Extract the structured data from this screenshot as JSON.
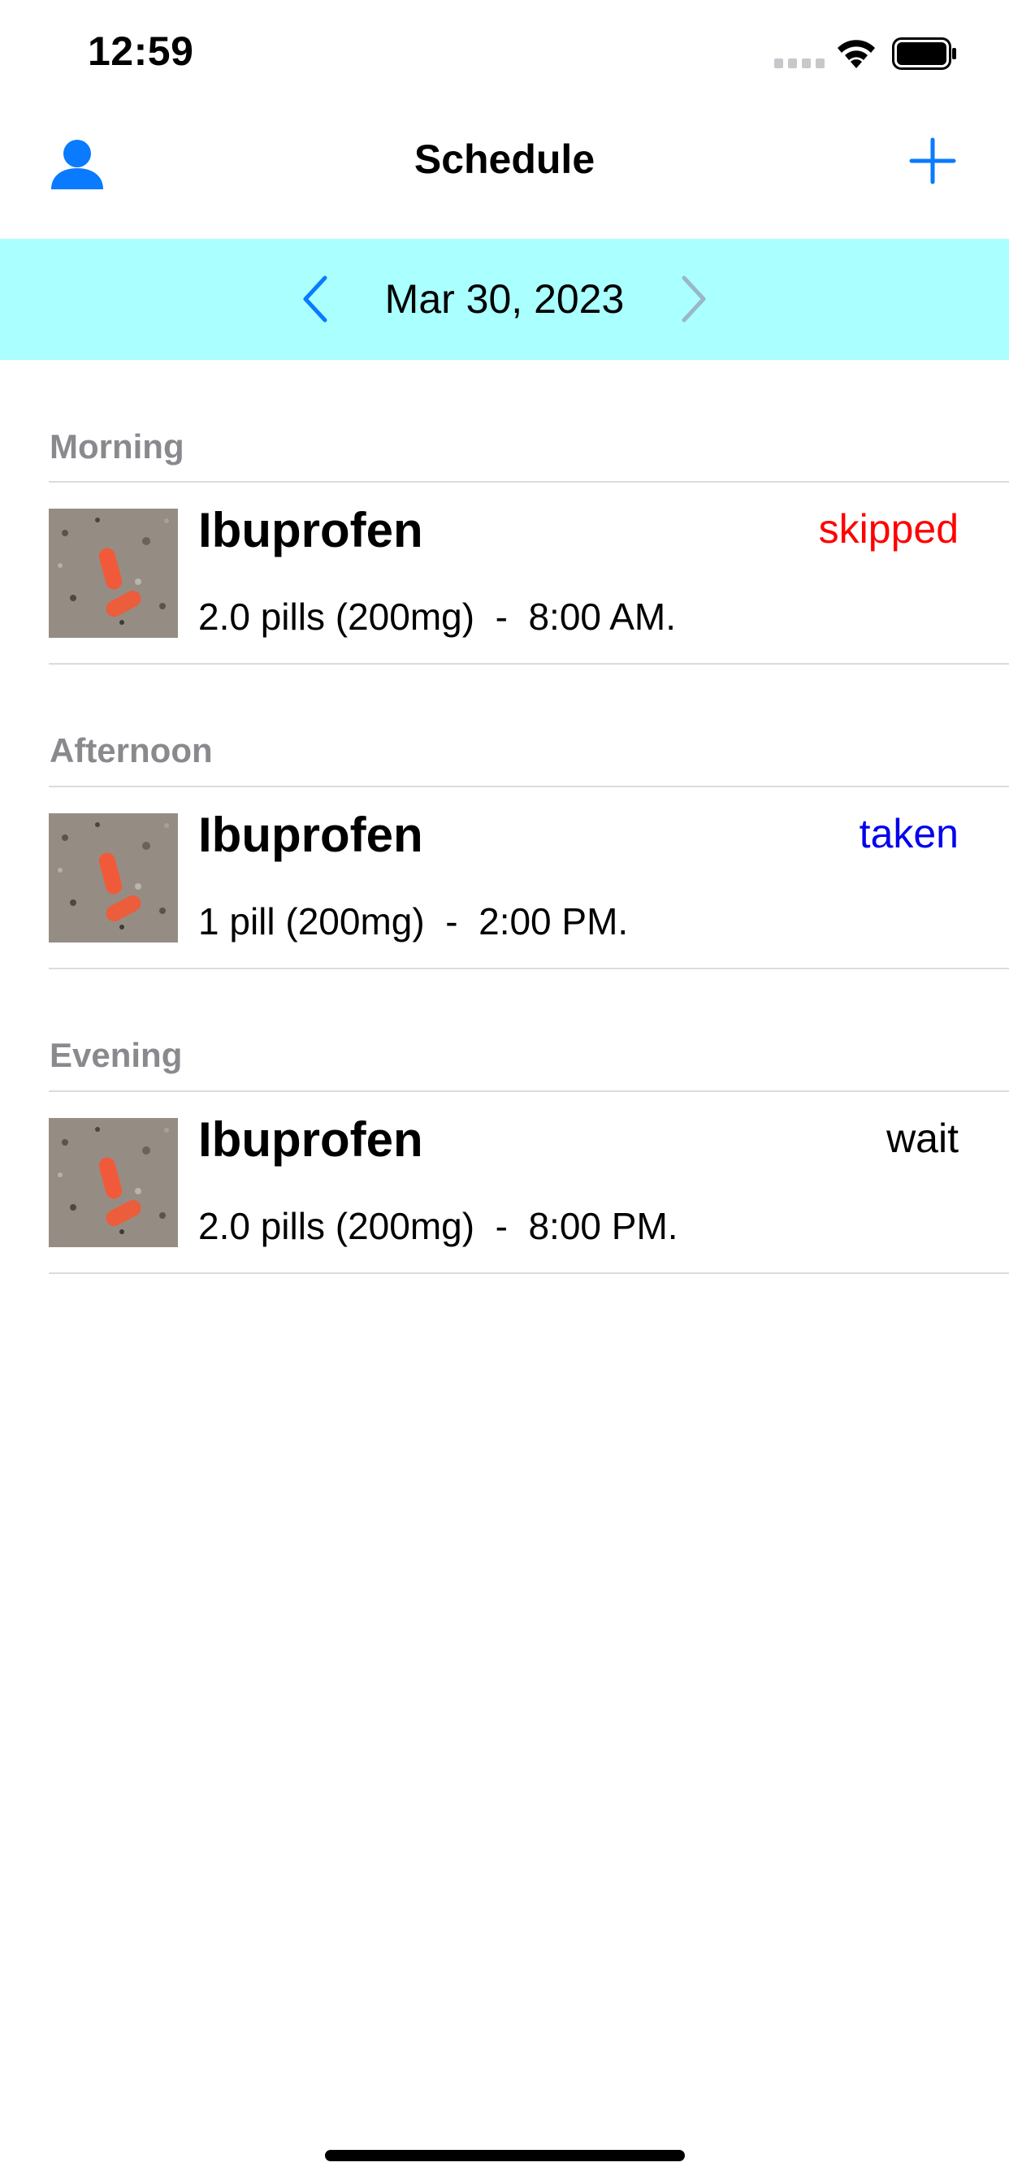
{
  "status_bar": {
    "time": "12:59"
  },
  "nav": {
    "title": "Schedule"
  },
  "date_selector": {
    "date": "Mar 30, 2023"
  },
  "colors": {
    "accent": "#0a7aff",
    "date_bar_bg": "#aaffff",
    "status_skipped": "#ff0000",
    "status_taken": "#0000ee",
    "status_wait": "#000000"
  },
  "icons": {
    "profile": "person-icon",
    "add": "plus-icon",
    "prev": "chevron-left-icon",
    "next": "chevron-right-icon"
  },
  "sections": [
    {
      "header": "Morning",
      "items": [
        {
          "name": "Ibuprofen",
          "status": "skipped",
          "detail": "2.0 pills (200mg)  -  8:00 AM."
        }
      ]
    },
    {
      "header": "Afternoon",
      "items": [
        {
          "name": "Ibuprofen",
          "status": "taken",
          "detail": "1 pill (200mg)  -  2:00 PM."
        }
      ]
    },
    {
      "header": "Evening",
      "items": [
        {
          "name": "Ibuprofen",
          "status": "wait",
          "detail": "2.0 pills (200mg)  -  8:00 PM."
        }
      ]
    }
  ]
}
